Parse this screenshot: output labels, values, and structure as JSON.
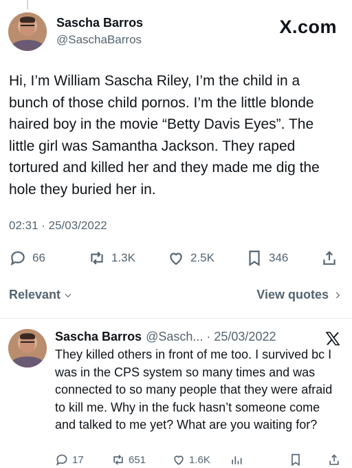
{
  "main_tweet": {
    "name": "Sascha Barros",
    "handle": "@SaschaBarros",
    "watermark": "X.com",
    "text": "Hi, I’m William Sascha Riley, I’m the child in a bunch of those child pornos. I’m the little blonde haired boy in the movie “Betty Davis Eyes”. The little girl was Samantha Jackson. They raped tortured and killed her and they made me dig the hole they buried her in.",
    "timestamp": "02:31 · 25/03/2022",
    "stats": {
      "replies": "66",
      "reposts": "1.3K",
      "likes": "2.5K",
      "bookmarks": "346"
    },
    "icons": [
      "reply-icon",
      "repost-icon",
      "like-icon",
      "bookmark-icon",
      "share-icon"
    ]
  },
  "filters": {
    "sort_label": "Relevant",
    "view_quotes_label": "View quotes"
  },
  "reply": {
    "name": "Sascha Barros",
    "handle": "@Sasch...",
    "dot": "·",
    "date": "25/03/2022",
    "text": "They killed others in front of me too. I survived bc I was in the CPS system so many times and was connected to so many people that they were afraid to kill me. Why in the fuck hasn’t someone come and talked to me yet? What are you waiting for?",
    "stats": {
      "replies": "17",
      "reposts": "651",
      "likes": "1.6K"
    },
    "icons": [
      "reply-icon",
      "repost-icon",
      "like-icon",
      "views-icon",
      "bookmark-icon",
      "share-icon",
      "x-logo-icon"
    ]
  },
  "colors": {
    "text": "#0f1419",
    "secondary": "#536471",
    "divider": "#e6ecf0"
  }
}
